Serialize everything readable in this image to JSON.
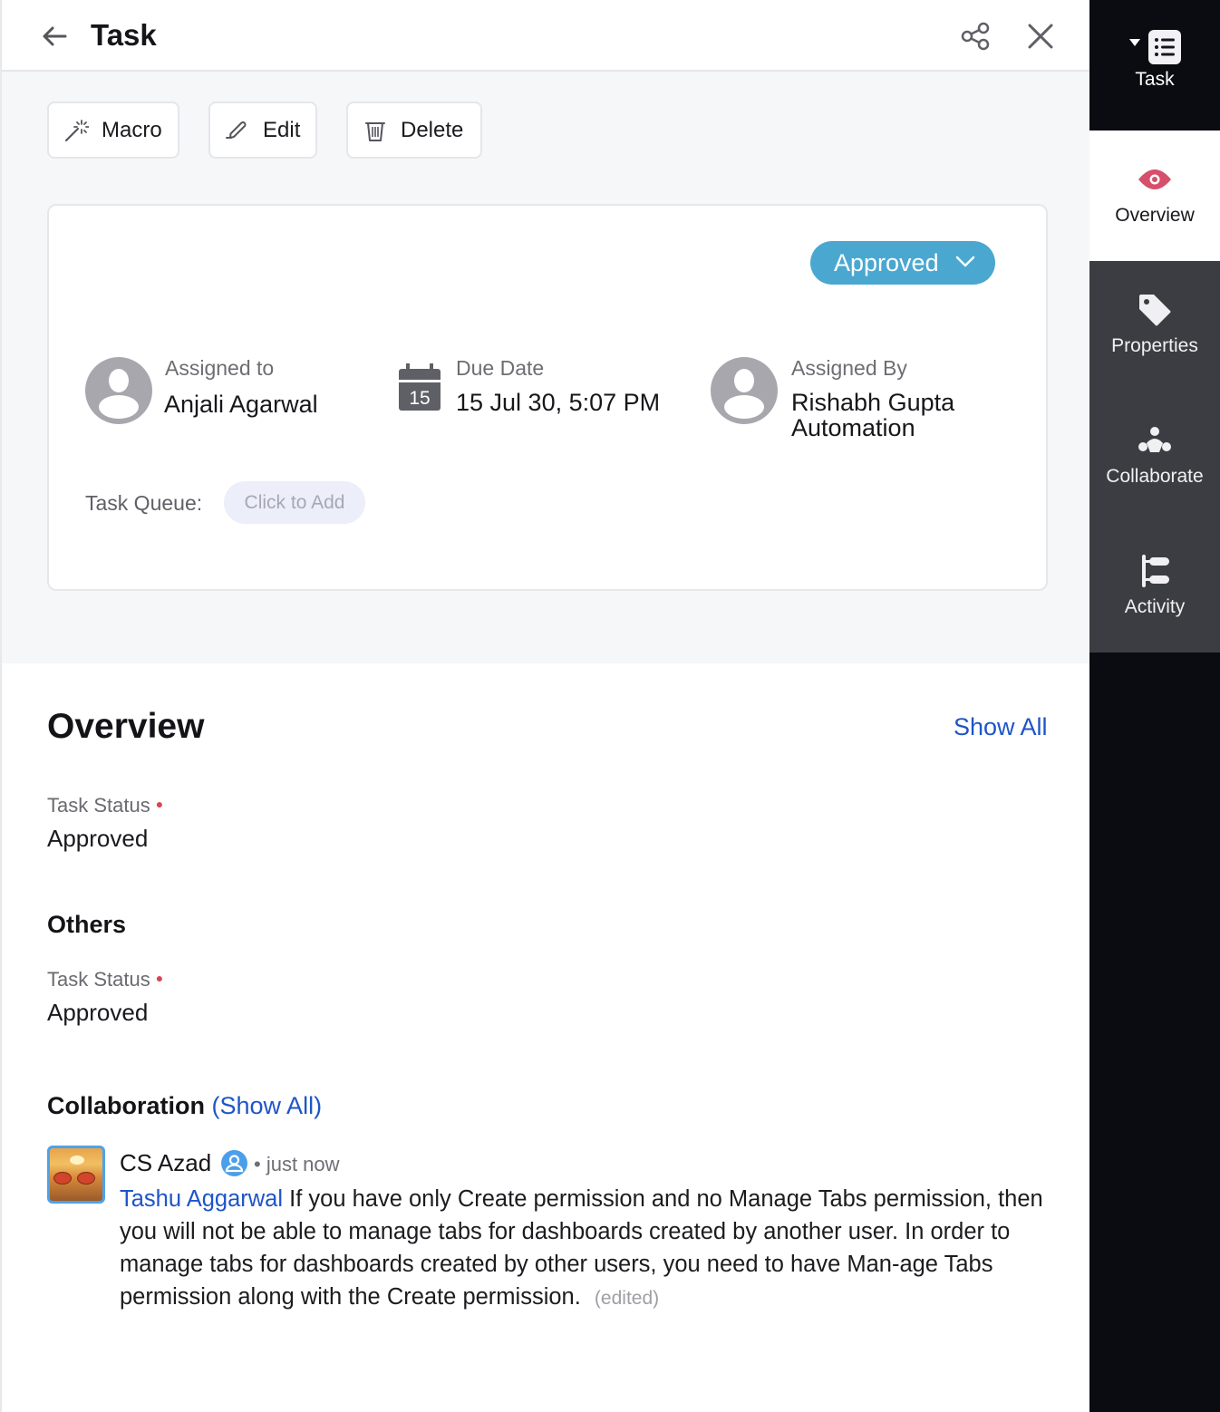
{
  "header": {
    "title": "Task",
    "back_icon": "arrow-left-icon",
    "share_icon": "share-icon",
    "close_icon": "close-icon"
  },
  "toolbar": {
    "macro_label": "Macro",
    "edit_label": "Edit",
    "delete_label": "Delete"
  },
  "card": {
    "status": "Approved",
    "status_color": "#4aa7d0",
    "assigned_to": {
      "label": "Assigned to",
      "value": "Anjali Agarwal"
    },
    "due_date": {
      "label": "Due Date",
      "value": "15 Jul 30, 5:07 PM",
      "calendar_day": "15"
    },
    "assigned_by": {
      "label": "Assigned By",
      "value_line1": "Rishabh Gupta",
      "value_line2": "Automation"
    },
    "task_queue": {
      "label": "Task Queue:",
      "placeholder": "Click to Add"
    }
  },
  "overview": {
    "title": "Overview",
    "show_all": "Show All",
    "fields": [
      {
        "label": "Task Status",
        "value": "Approved",
        "required": true
      }
    ]
  },
  "others": {
    "title": "Others",
    "fields": [
      {
        "label": "Task Status",
        "value": "Approved",
        "required": true
      }
    ]
  },
  "collaboration": {
    "title": "Collaboration",
    "show_all": "(Show All)",
    "comments": [
      {
        "author": "CS Azad",
        "time": "just now",
        "mention": "Tashu Aggarwal",
        "text": "If you have only Create permission and no Manage Tabs permission, then you will not be able to manage tabs for dashboards created by another user. In order to manage tabs for dashboards created by other users, you need to have Man-age Tabs permission along with the Create permission.",
        "edited": "(edited)"
      }
    ]
  },
  "rail": {
    "items": [
      {
        "label": "Task",
        "icon": "list-icon"
      },
      {
        "label": "Overview",
        "icon": "eye-icon",
        "active": true
      },
      {
        "label": "Properties",
        "icon": "tag-icon"
      },
      {
        "label": "Collaborate",
        "icon": "collaborate-icon"
      },
      {
        "label": "Activity",
        "icon": "activity-icon"
      }
    ]
  },
  "colors": {
    "accent_link": "#1e55c8",
    "status_pill": "#4aa7d0",
    "required_dot": "#d94552",
    "overview_icon": "#d6506b"
  }
}
